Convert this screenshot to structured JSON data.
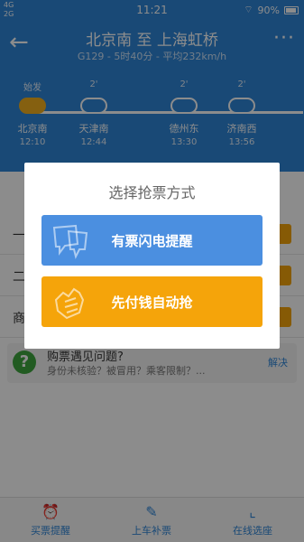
{
  "status_bar": {
    "network_top": "4G",
    "network_bottom": "2G",
    "time": "11:21",
    "battery": "90%"
  },
  "header": {
    "title": "北京南 至 上海虹桥",
    "subtitle": "G129 - 5时40分 - 平均232km/h"
  },
  "route": {
    "stops": [
      {
        "top_label": "始发",
        "name": "北京南",
        "time": "12:10",
        "is_origin": true
      },
      {
        "top_label": "2'",
        "name": "天津南",
        "time": "12:44",
        "is_origin": false
      },
      {
        "top_label": "2'",
        "name": "德州东",
        "time": "13:30",
        "is_origin": false
      },
      {
        "top_label": "2'",
        "name": "济南西",
        "time": "13:56",
        "is_origin": false
      }
    ]
  },
  "seat_rows": [
    {
      "label": "一"
    },
    {
      "label": "二"
    },
    {
      "label": "商"
    }
  ],
  "help": {
    "icon": "question-icon",
    "title": "购票遇见问题?",
    "description": "身份未核验？被冒用？乘客限制？...",
    "action": "解决"
  },
  "bottom_nav": [
    {
      "icon": "clock-icon",
      "label": "买票提醒"
    },
    {
      "icon": "ticket-icon",
      "label": "上车补票"
    },
    {
      "icon": "seat-icon",
      "label": "在线选座"
    }
  ],
  "dialog": {
    "title": "选择抢票方式",
    "options": [
      {
        "label": "有票闪电提醒",
        "icon": "chat-bubble-icon",
        "color": "#4b8fe0"
      },
      {
        "label": "先付钱自动抢",
        "icon": "hand-icon",
        "color": "#f5a40a"
      }
    ]
  }
}
